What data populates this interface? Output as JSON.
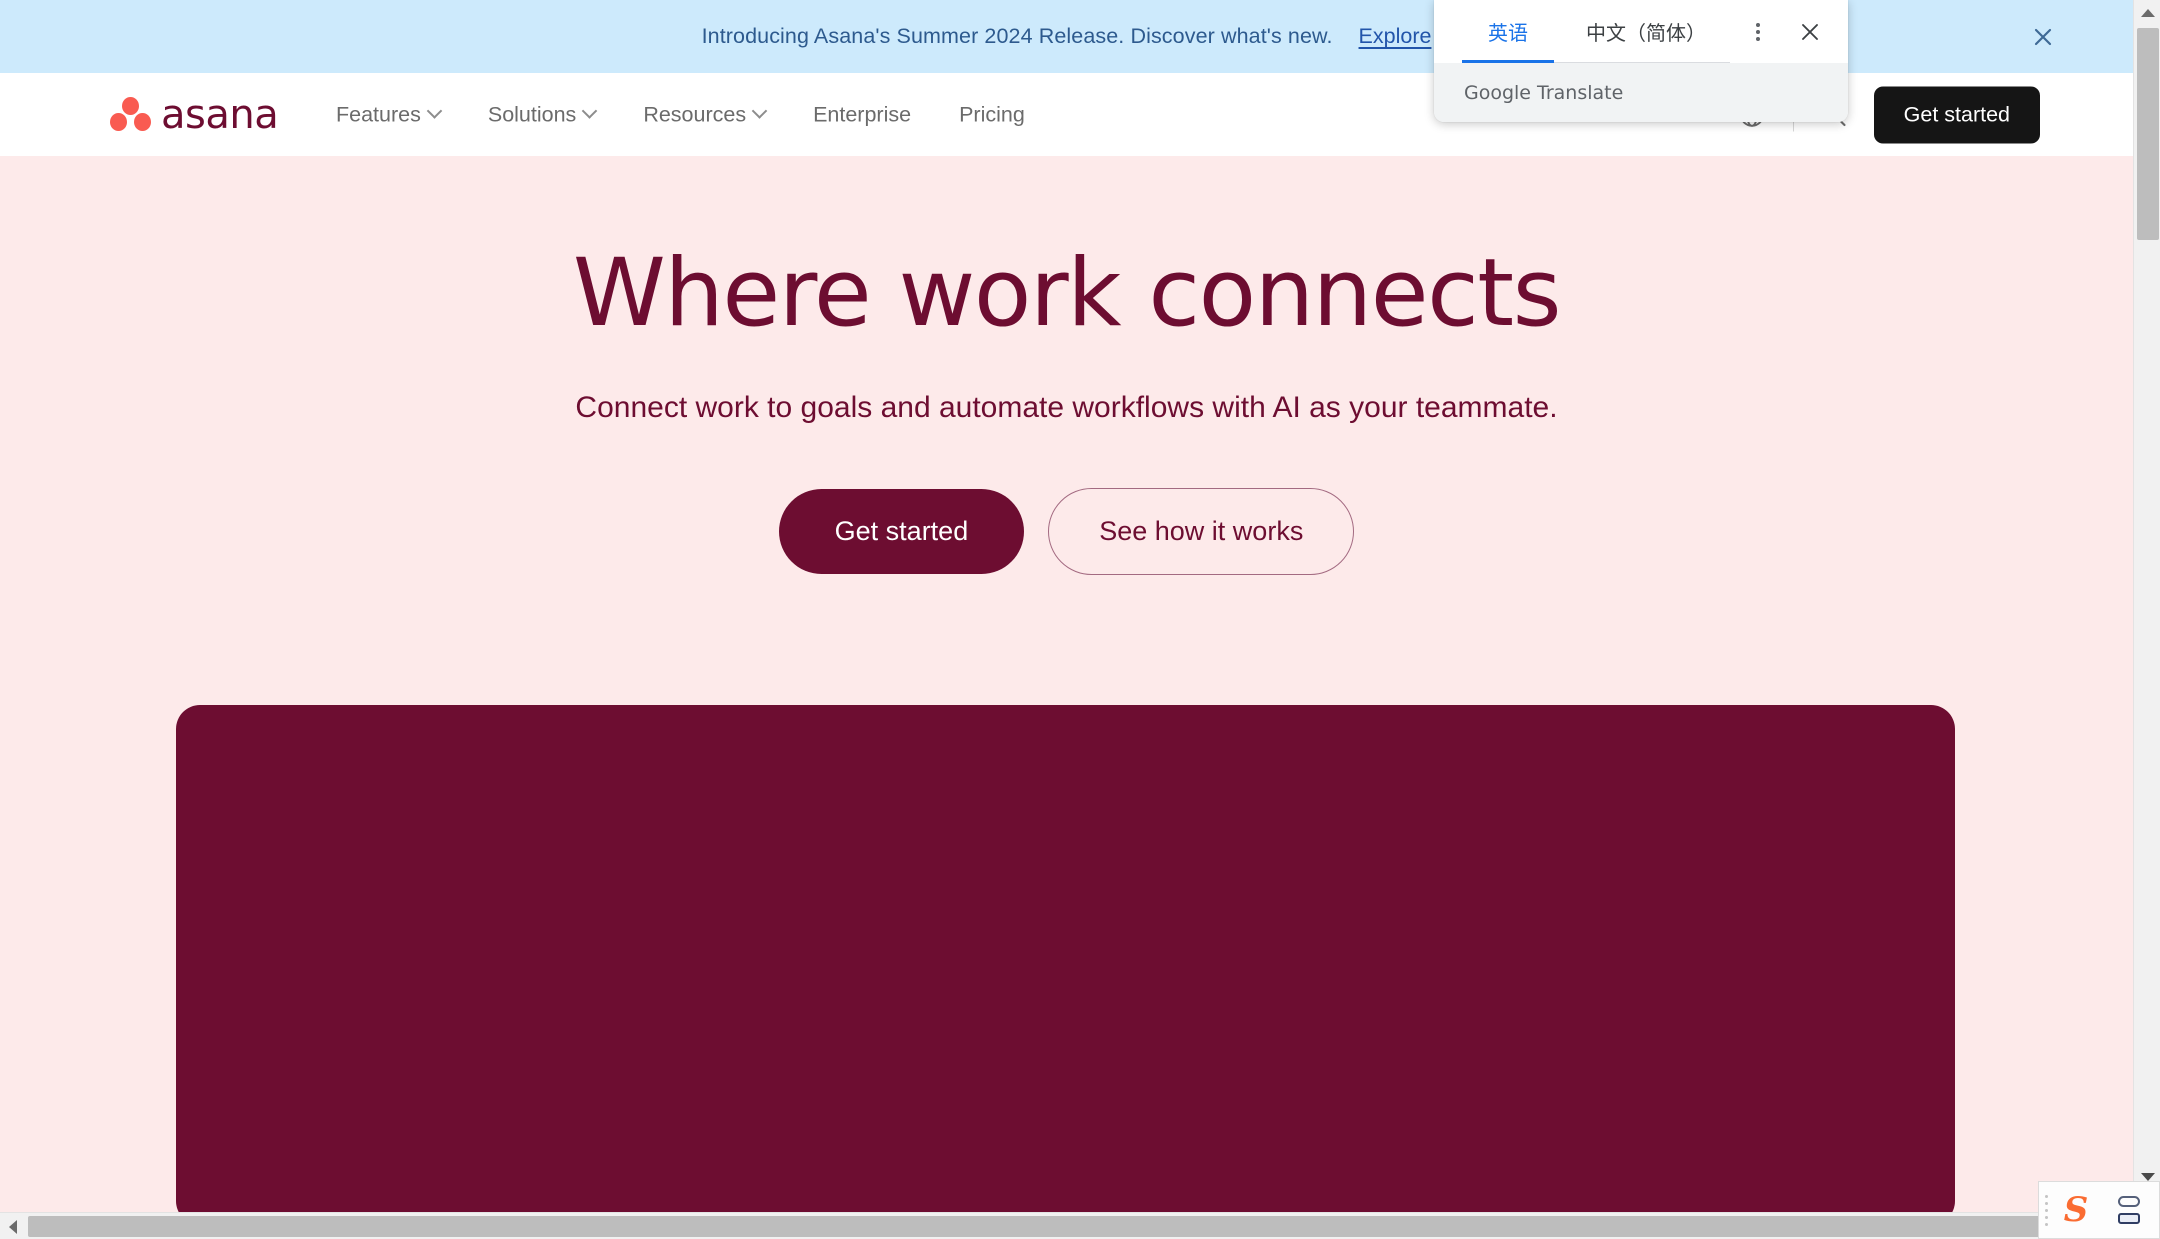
{
  "banner": {
    "text": "Introducing Asana's Summer 2024 Release. Discover what's new.",
    "link_label": "Explore",
    "close_label": "×",
    "background_color": "#cdeafc",
    "text_color": "#2d5a8e"
  },
  "nav": {
    "logo_text": "asana",
    "logo_dot_color": "#f95b51",
    "logo_text_color": "#6d0d31",
    "items": [
      {
        "label": "Features",
        "has_dropdown": true
      },
      {
        "label": "Solutions",
        "has_dropdown": true
      },
      {
        "label": "Resources",
        "has_dropdown": true
      },
      {
        "label": "Enterprise",
        "has_dropdown": false
      },
      {
        "label": "Pricing",
        "has_dropdown": false
      }
    ],
    "right": {
      "globe_icon": "globe-icon",
      "search_icon": "search-icon",
      "get_started_label": "Get started",
      "get_started_bg": "#151515"
    }
  },
  "hero": {
    "title": "Where work connects",
    "subtitle": "Connect work to goals and automate workflows with AI as your teammate.",
    "primary_cta": "Get started",
    "secondary_cta": "See how it works",
    "background_color": "#fdeaea",
    "accent_color": "#6d0d31"
  },
  "translate_popup": {
    "tabs": [
      {
        "label": "英语",
        "active": true
      },
      {
        "label": "中文（简体）",
        "active": false
      }
    ],
    "menu_icon": "kebab-menu-icon",
    "close_icon": "close-icon",
    "footer_label": "Google Translate",
    "active_color": "#1a73e8"
  },
  "browser_chrome": {
    "vertical_scrollbar": "vertical-scrollbar",
    "horizontal_scrollbar": "horizontal-scrollbar",
    "ime_badge_letter": "S"
  }
}
